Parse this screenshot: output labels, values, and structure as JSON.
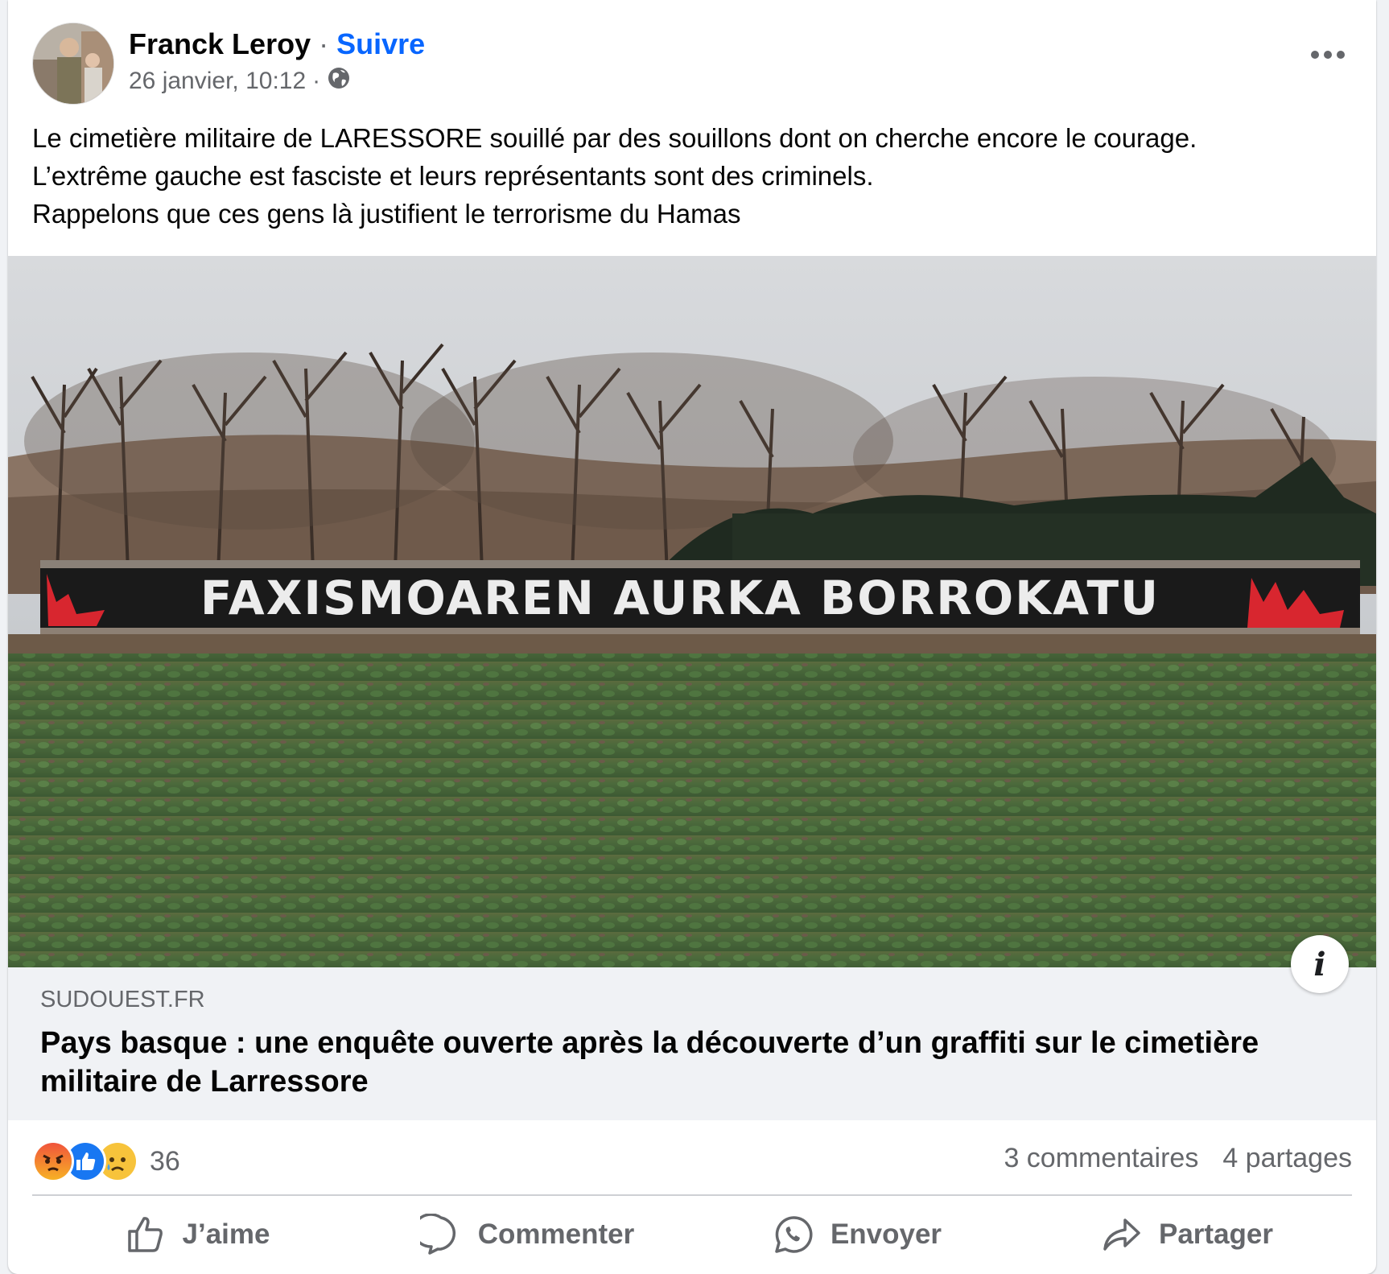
{
  "post": {
    "author": "Franck Leroy",
    "separator": "·",
    "follow_label": "Suivre",
    "timestamp": "26 janvier, 10:12",
    "meta_separator": "·",
    "audience_icon": "globe-icon",
    "more_icon": "more-horizontal-icon",
    "text_lines": [
      "Le cimetière militaire de LARESSORE souillé par des souillons dont on cherche encore le courage.",
      "L’extrême gauche est fasciste et leurs représentants sont des criminels.",
      "Rappelons que ces gens là justifient le terrorisme du Hamas"
    ]
  },
  "photo": {
    "graffiti_text": "FAXISMOAREN AURKA BORROKATU"
  },
  "link": {
    "domain": "SUDOUEST.FR",
    "headline": "Pays basque : une enquête ouverte après la découverte d’un graffiti sur le cimetière militaire de Larressore",
    "info_icon": "info-icon",
    "info_label": "i"
  },
  "stats": {
    "reaction_icons": [
      "angry-reaction-icon",
      "like-reaction-icon",
      "sad-reaction-icon"
    ],
    "reaction_count": "36",
    "comments": "3 commentaires",
    "shares": "4 partages"
  },
  "actions": {
    "like": "J’aime",
    "comment": "Commenter",
    "send": "Envoyer",
    "share": "Partager"
  },
  "colors": {
    "accent": "#0866ff",
    "text": "#050505",
    "secondary_text": "#65676b",
    "card_background": "#f0f2f5",
    "flame_red": "#d8262f"
  }
}
